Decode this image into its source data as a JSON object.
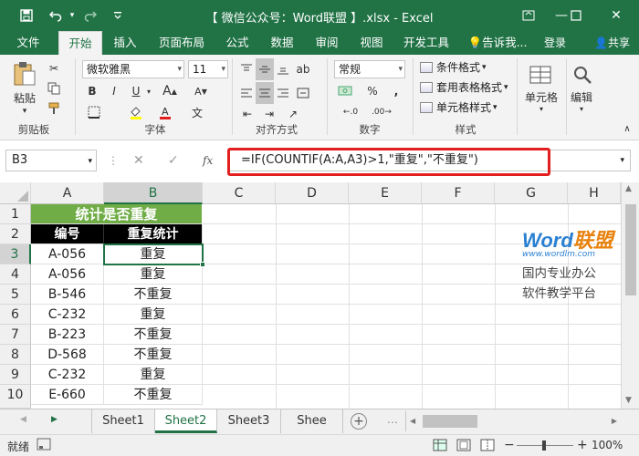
{
  "window": {
    "title": "【 微信公众号：Word联盟 】.xlsx - Excel",
    "minimize": "—",
    "restore": "❐",
    "close": "✕"
  },
  "quick_access": {
    "save": "💾",
    "undo": "↶",
    "redo": "↷",
    "customize": "⌄"
  },
  "tabs": [
    {
      "label": "文件"
    },
    {
      "label": "开始"
    },
    {
      "label": "插入"
    },
    {
      "label": "页面布局"
    },
    {
      "label": "公式"
    },
    {
      "label": "数据"
    },
    {
      "label": "审阅"
    },
    {
      "label": "视图"
    },
    {
      "label": "开发工具"
    },
    {
      "label": "告诉我..."
    }
  ],
  "account": {
    "signin": "登录",
    "share": "共享"
  },
  "ribbon": {
    "clipboard": {
      "label": "剪贴板",
      "paste": "粘贴"
    },
    "font": {
      "label": "字体",
      "name": "微软雅黑",
      "size": "11",
      "bold": "B",
      "italic": "I",
      "underline": "U"
    },
    "alignment": {
      "label": "对齐方式"
    },
    "number": {
      "label": "数字",
      "format": "常规",
      "percent": "%",
      "comma": ","
    },
    "styles": {
      "label": "样式",
      "conditional": "条件格式",
      "table": "套用表格格式",
      "cell_styles": "单元格样式"
    },
    "cells": {
      "label": "单元格"
    },
    "editing": {
      "label": "编辑"
    }
  },
  "formula_bar": {
    "name_box": "B3",
    "fx": "fx",
    "cancel": "✕",
    "enter": "✓",
    "formula": "=IF(COUNTIF(A:A,A3)>1,\"重复\",\"不重复\")"
  },
  "columns": [
    "A",
    "B",
    "C",
    "D",
    "E",
    "F",
    "G",
    "H"
  ],
  "rows": [
    "1",
    "2",
    "3",
    "4",
    "5",
    "6",
    "7",
    "8",
    "9",
    "10"
  ],
  "sheet": {
    "title": "统计是否重复",
    "header": {
      "a": "编号",
      "b": "重复统计"
    },
    "data": [
      {
        "a": "A-056",
        "b": "重复"
      },
      {
        "a": "A-056",
        "b": "重复"
      },
      {
        "a": "B-546",
        "b": "不重复"
      },
      {
        "a": "C-232",
        "b": "重复"
      },
      {
        "a": "B-223",
        "b": "不重复"
      },
      {
        "a": "D-568",
        "b": "不重复"
      },
      {
        "a": "C-232",
        "b": "重复"
      },
      {
        "a": "E-660",
        "b": "不重复"
      }
    ]
  },
  "watermark": {
    "brand_word": "Word",
    "brand_cn": "联盟",
    "url": "www.wordlm.com",
    "line1": "国内专业办公",
    "line2": "软件教学平台"
  },
  "sheet_tabs": [
    {
      "label": "Sheet1"
    },
    {
      "label": "Sheet2"
    },
    {
      "label": "Sheet3"
    },
    {
      "label": "Shee"
    }
  ],
  "sheet_nav": {
    "prev": "◀",
    "next": "▶",
    "add": "+",
    "more": "…"
  },
  "status": {
    "ready": "就绪",
    "zoom": "100%",
    "zoom_minus": "−",
    "zoom_plus": "+"
  },
  "colors": {
    "excel_green": "#217346",
    "title_fill": "#70ad47",
    "header_fill": "#000000",
    "highlight": "#e21e1e"
  }
}
